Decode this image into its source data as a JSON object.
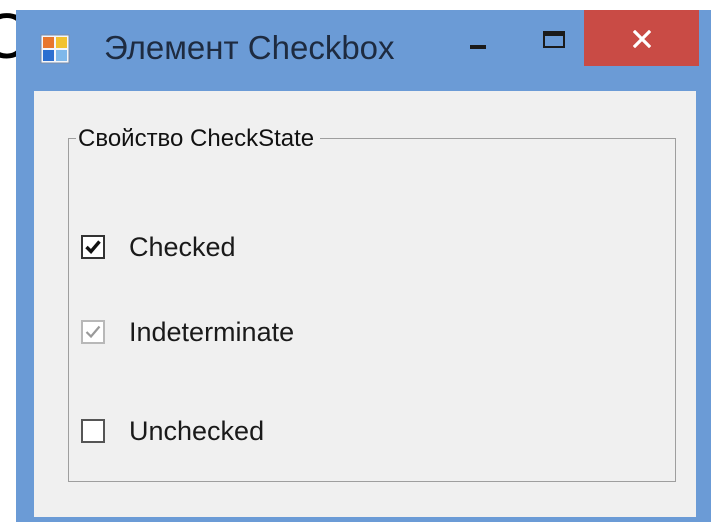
{
  "window": {
    "title": "Элемент Checkbox",
    "controls": {
      "minimize": "minimize",
      "maximize": "maximize",
      "close": "close"
    }
  },
  "groupbox": {
    "label": "Свойство CheckState"
  },
  "checkboxes": [
    {
      "label": "Checked",
      "state": "checked"
    },
    {
      "label": "Indeterminate",
      "state": "indeterminate"
    },
    {
      "label": "Unchecked",
      "state": "unchecked"
    }
  ],
  "icons": {
    "app": "app-icon",
    "minimize": "minimize-icon",
    "maximize": "maximize-icon",
    "close": "close-icon",
    "check": "check-icon"
  },
  "colors": {
    "frame": "#6b9bd6",
    "close_button": "#c94b45",
    "client_background": "#f0f0f0",
    "groupbox_border": "#9e9e9e",
    "indeterminate_mark": "#9a9a9a"
  },
  "background_fragment": "С"
}
